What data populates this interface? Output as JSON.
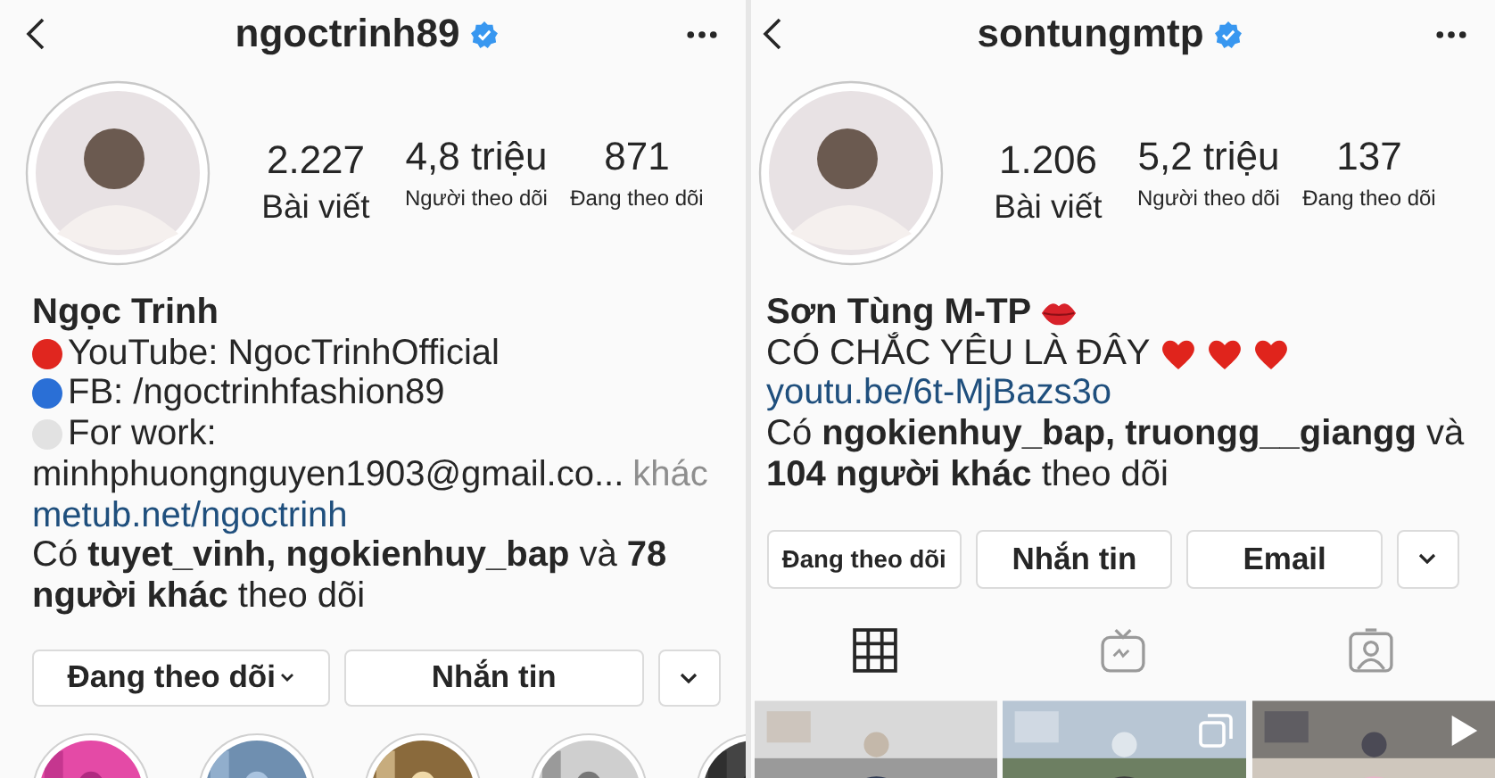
{
  "profiles": [
    {
      "username": "ngoctrinh89",
      "verified": true,
      "stats": [
        {
          "kind": "posts",
          "value": "2.227",
          "label": "Bài viết"
        },
        {
          "kind": "followers",
          "value": "4,8 triệu",
          "label": "Người theo dõi"
        },
        {
          "kind": "following",
          "value": "871",
          "label": "Đang theo dõi"
        }
      ],
      "name": "Ngọc Trinh",
      "bio": [
        {
          "kind": "bullet",
          "color": "#e0261f",
          "text": "YouTube: NgocTrinhOfficial"
        },
        {
          "kind": "bullet",
          "color": "#2a6fd6",
          "text": "FB: /ngoctrinhfashion89"
        },
        {
          "kind": "bullet",
          "color": "#e2e2e2",
          "text": "For work:"
        },
        {
          "kind": "truncated",
          "text": "minhphuongnguyen1903@gmail.co...",
          "more": "khác"
        }
      ],
      "link": "metub.net/ngoctrinh",
      "followed_by": "Có **tuyet_vinh, ngokienhuy_bap** và **78 người khác** theo dõi",
      "buttons": [
        {
          "kind": "follow",
          "label": "Đang theo dõi",
          "dropdown": true
        },
        {
          "kind": "text",
          "label": "Nhắn tin"
        },
        {
          "kind": "chevron"
        }
      ],
      "highlights": [
        {
          "kind": "picture"
        },
        {
          "kind": "picture"
        },
        {
          "kind": "picture"
        },
        {
          "kind": "picture"
        },
        {
          "kind": "picture"
        }
      ]
    },
    {
      "username": "sontungmtp",
      "verified": true,
      "stats": [
        {
          "kind": "posts",
          "value": "1.206",
          "label": "Bài viết"
        },
        {
          "kind": "followers",
          "value": "5,2 triệu",
          "label": "Người theo dõi"
        },
        {
          "kind": "following",
          "value": "137",
          "label": "Đang theo dõi"
        }
      ],
      "name": "Sơn Tùng M-TP",
      "name_emoji": {
        "kind": "lips"
      },
      "bio": [
        {
          "kind": "plain",
          "text": "CÓ CHẮC YÊU LÀ ĐÂY",
          "emojis": [
            {
              "kind": "heart"
            },
            {
              "kind": "heart"
            },
            {
              "kind": "heart"
            }
          ]
        }
      ],
      "link": "youtu.be/6t-MjBazs3o",
      "followed_by": "Có **ngokienhuy_bap, truongg__giangg** và **104 người khác** theo dõi",
      "buttons": [
        {
          "kind": "follow",
          "label": "Đang theo dõi",
          "dropdown": false
        },
        {
          "kind": "text",
          "label": "Nhắn tin"
        },
        {
          "kind": "text",
          "label": "Email"
        },
        {
          "kind": "chevron"
        }
      ],
      "tabs": [
        {
          "kind": "grid",
          "selected": true
        },
        {
          "kind": "igtv",
          "selected": false
        },
        {
          "kind": "tagged",
          "selected": false
        }
      ],
      "posts": [
        {
          "kind": "picture"
        },
        {
          "kind": "picture",
          "overlay": {
            "kind": "carousel"
          }
        },
        {
          "kind": "picture",
          "overlay": {
            "kind": "video"
          }
        }
      ]
    }
  ]
}
